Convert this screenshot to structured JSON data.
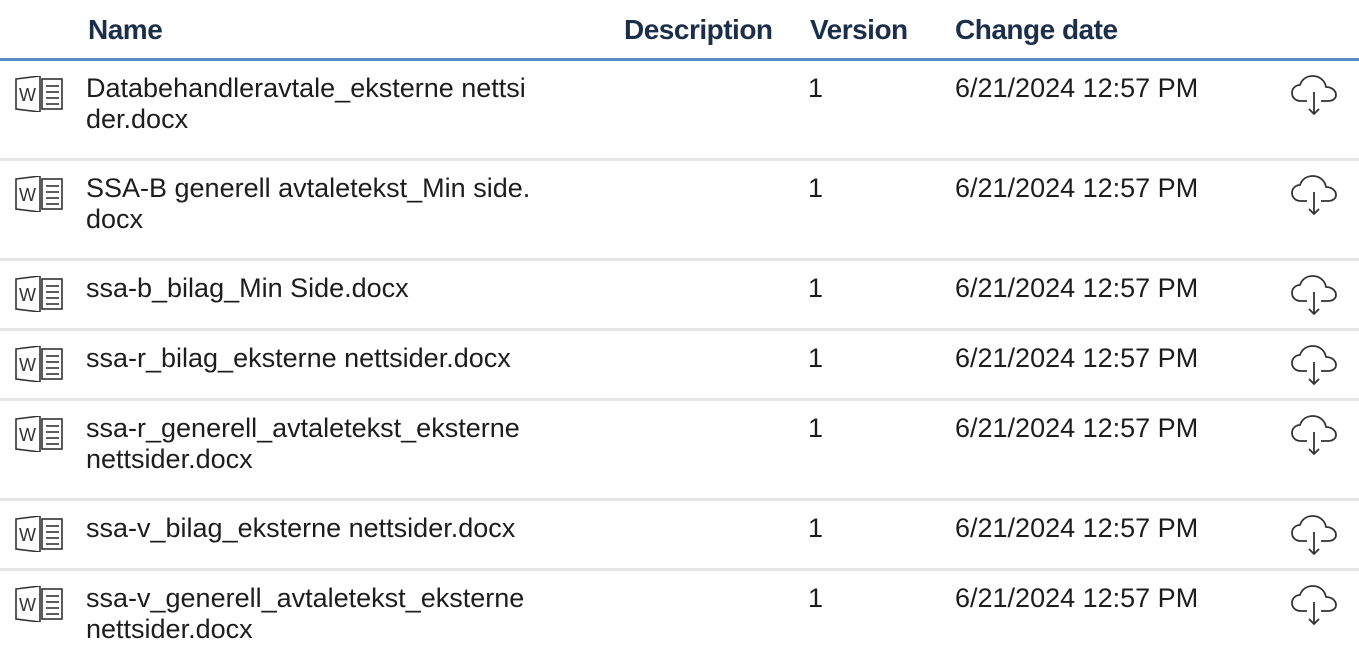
{
  "columns": {
    "name": "Name",
    "description": "Description",
    "version": "Version",
    "change_date": "Change date"
  },
  "files": [
    {
      "name_line1": "Databehandleravtale_eksterne nettsi",
      "name_line2": "der.docx",
      "version": "1",
      "date": "6/21/2024 12:57 PM",
      "icon": "word-doc-icon"
    },
    {
      "name_line1": "SSA-B generell avtaletekst_Min side.",
      "name_line2": "docx",
      "version": "1",
      "date": "6/21/2024 12:57 PM",
      "icon": "word-doc-icon"
    },
    {
      "name_line1": "ssa-b_bilag_Min Side.docx",
      "name_line2": "",
      "version": "1",
      "date": "6/21/2024 12:57 PM",
      "icon": "word-doc-icon"
    },
    {
      "name_line1": "ssa-r_bilag_eksterne nettsider.docx",
      "name_line2": "",
      "version": "1",
      "date": "6/21/2024 12:57 PM",
      "icon": "word-doc-icon"
    },
    {
      "name_line1": "ssa-r_generell_avtaletekst_eksterne",
      "name_line2": "nettsider.docx",
      "version": "1",
      "date": "6/21/2024 12:57 PM",
      "icon": "word-doc-icon"
    },
    {
      "name_line1": "ssa-v_bilag_eksterne nettsider.docx",
      "name_line2": "",
      "version": "1",
      "date": "6/21/2024 12:57 PM",
      "icon": "word-doc-icon"
    },
    {
      "name_line1": "ssa-v_generell_avtaletekst_eksterne",
      "name_line2": "nettsider.docx",
      "version": "1",
      "date": "6/21/2024 12:57 PM",
      "icon": "word-doc-icon"
    }
  ],
  "download_icon": "cloud-download-icon"
}
